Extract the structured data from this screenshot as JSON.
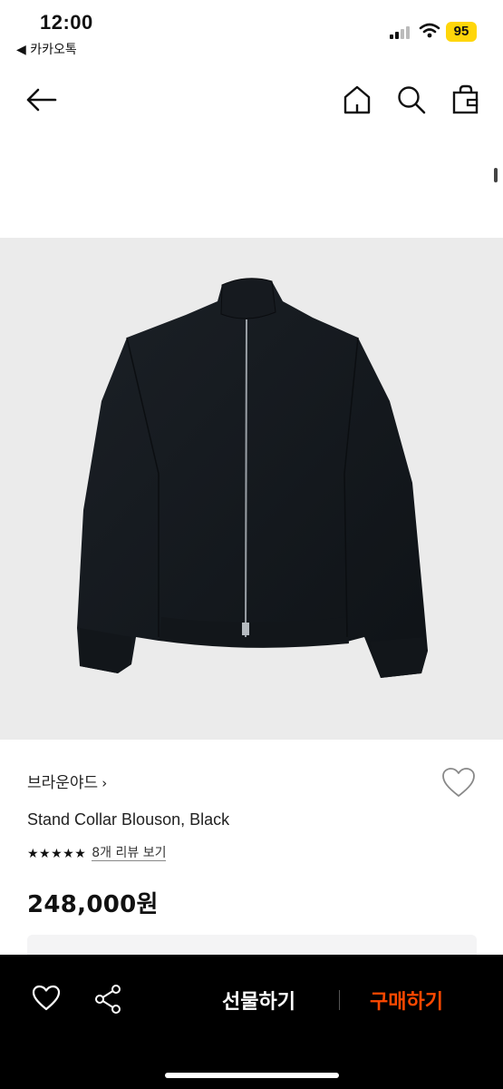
{
  "status_bar": {
    "time": "12:00",
    "back_app": "◀ 카카오톡",
    "battery": "95",
    "battery_color": "#ffd60a"
  },
  "nav": {
    "back_icon": "arrow-left-icon",
    "home_icon": "home-icon",
    "search_icon": "search-icon",
    "bag_icon": "shopping-bag-icon"
  },
  "product": {
    "image_icon": "black-jacket-image",
    "brand": "브라운야드",
    "brand_chevron": "›",
    "name": "Stand Collar Blouson, Black",
    "stars": "★★★★★",
    "rating": 5,
    "review_link": "8개 리뷰 보기",
    "price": "248,000원"
  },
  "bottom_bar": {
    "wish_icon": "heart-icon",
    "share_icon": "share-icon",
    "gift_label": "선물하기",
    "buy_label": "구매하기",
    "buy_color": "#ff4800"
  }
}
